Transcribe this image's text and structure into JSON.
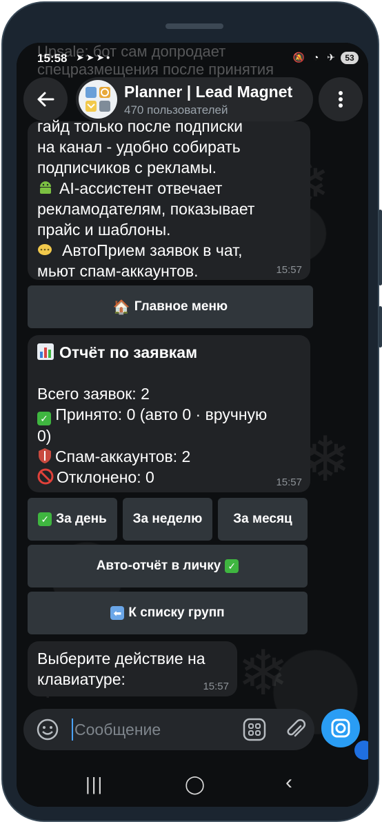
{
  "status_bar": {
    "time": "15:58",
    "battery": "53"
  },
  "background_preview_text": "Upsale: бот сам допродает спецразмещения после принятия",
  "header": {
    "title": "Planner | Lead Magnet",
    "subtitle": "470 пользователей"
  },
  "messages": {
    "m1": {
      "line1": "гайд только после подписки",
      "line2": "на канал - удобно собирать",
      "line3": "подписчиков с рекламы.",
      "line4": "AI-ассистент отвечает",
      "line5": "рекламодателям, показывает",
      "line6": "прайс и шаблоны.",
      "line7": "АвтоПрием заявок в чат,",
      "line8": "мьют спам-аккаунтов.",
      "time": "15:57"
    },
    "m2": {
      "title": "Отчёт по заявкам",
      "total": "Всего заявок: 2",
      "accepted": "Принято: 0 (авто 0 · вручную",
      "accepted_cont": "0)",
      "spam": "Спам-аккаунтов: 2",
      "rejected": "Отклонено: 0",
      "time": "15:57"
    },
    "m3": {
      "line1": "Выберите действие на",
      "line2": "клавиатуре:",
      "time": "15:57"
    }
  },
  "buttons": {
    "main_menu": "Главное меню",
    "day": "За день",
    "week": "За неделю",
    "month": "За месяц",
    "auto_report": "Авто-отчёт в личку",
    "back_to_groups": "К списку групп"
  },
  "input": {
    "placeholder": "Сообщение"
  },
  "icons": {
    "back": "arrow-left-icon",
    "menu": "kebab-menu-icon",
    "emoji": "smile-icon",
    "attach": "paperclip-icon",
    "camera": "camera-icon",
    "commands": "grid-icon"
  },
  "colors": {
    "accent": "#2a9df4",
    "bubble": "#212326",
    "button": "#30363b",
    "check": "#3fb640"
  }
}
